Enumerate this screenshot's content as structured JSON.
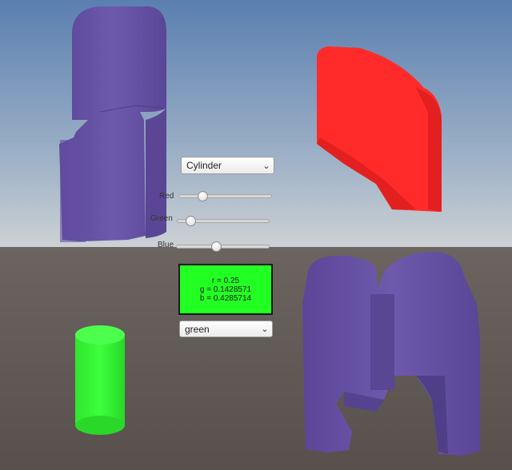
{
  "shape_dropdown": {
    "selected": "Cylinder"
  },
  "sliders": [
    {
      "label": "Red",
      "value": 0.25
    },
    {
      "label": "Green",
      "value": 0.1428571
    },
    {
      "label": "Blue",
      "value": 0.4285714
    }
  ],
  "color_readout": {
    "r": "r = 0.25",
    "g": "g = 0.1428571",
    "b": "b = 0.4285714",
    "fill_color": "#22ff22"
  },
  "color_dropdown": {
    "selected": "green"
  },
  "colors": {
    "sky_top": "#5a7fb0",
    "sky_horizon": "#c9cfd4",
    "ground": "#5e5752",
    "purple": "#6a55a8",
    "red": "#ff2b2b",
    "green": "#33f533"
  },
  "icons": {
    "dropdown_arrow": "chevron-down-icon"
  }
}
